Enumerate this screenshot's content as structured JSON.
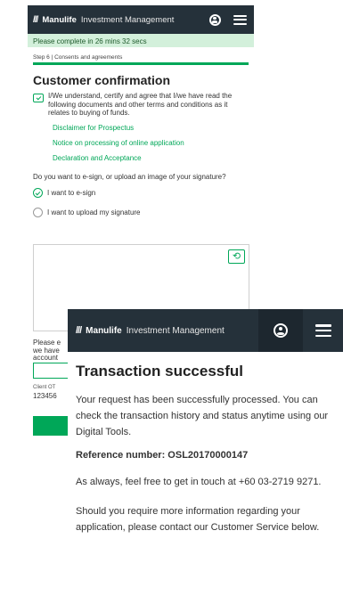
{
  "brand": {
    "mark": "///",
    "name": "Manulife",
    "tagline": "Investment Management"
  },
  "back_screen": {
    "timer": "Please complete in 26 mins 32 secs",
    "step": "Step 6 | Consents and agreements",
    "title": "Customer confirmation",
    "consent_text": "I/We understand, certify and agree that I/we have read the following documents and other terms and conditions as it relates to buying of funds.",
    "links": [
      "Disclaimer for Prospectus",
      "Notice on processing of online application",
      "Declaration and Acceptance"
    ],
    "signature_question": "Do you want to e-sign, or upload an image of your signature?",
    "options": [
      {
        "label": "I want to e-sign",
        "selected": true
      },
      {
        "label": "I want to upload my signature",
        "selected": false
      }
    ],
    "partial_lines": [
      "Please e",
      "we have",
      "account"
    ],
    "client_otp_label": "Client OT",
    "client_otp_value": "123456"
  },
  "front_screen": {
    "title": "Transaction successful",
    "message": "Your request has been successfully processed. You can check the transaction history and status anytime using our Digital Tools.",
    "reference": "Reference number: OSL20170000147",
    "contact": "As always, feel free to get in touch at +60 03-2719 9271.",
    "more_info": "Should you require more information regarding your application, please contact our Customer Service below."
  },
  "colors": {
    "header_bg": "#25313a",
    "accent_green": "#00a758",
    "timer_bg": "#d3f0db"
  }
}
